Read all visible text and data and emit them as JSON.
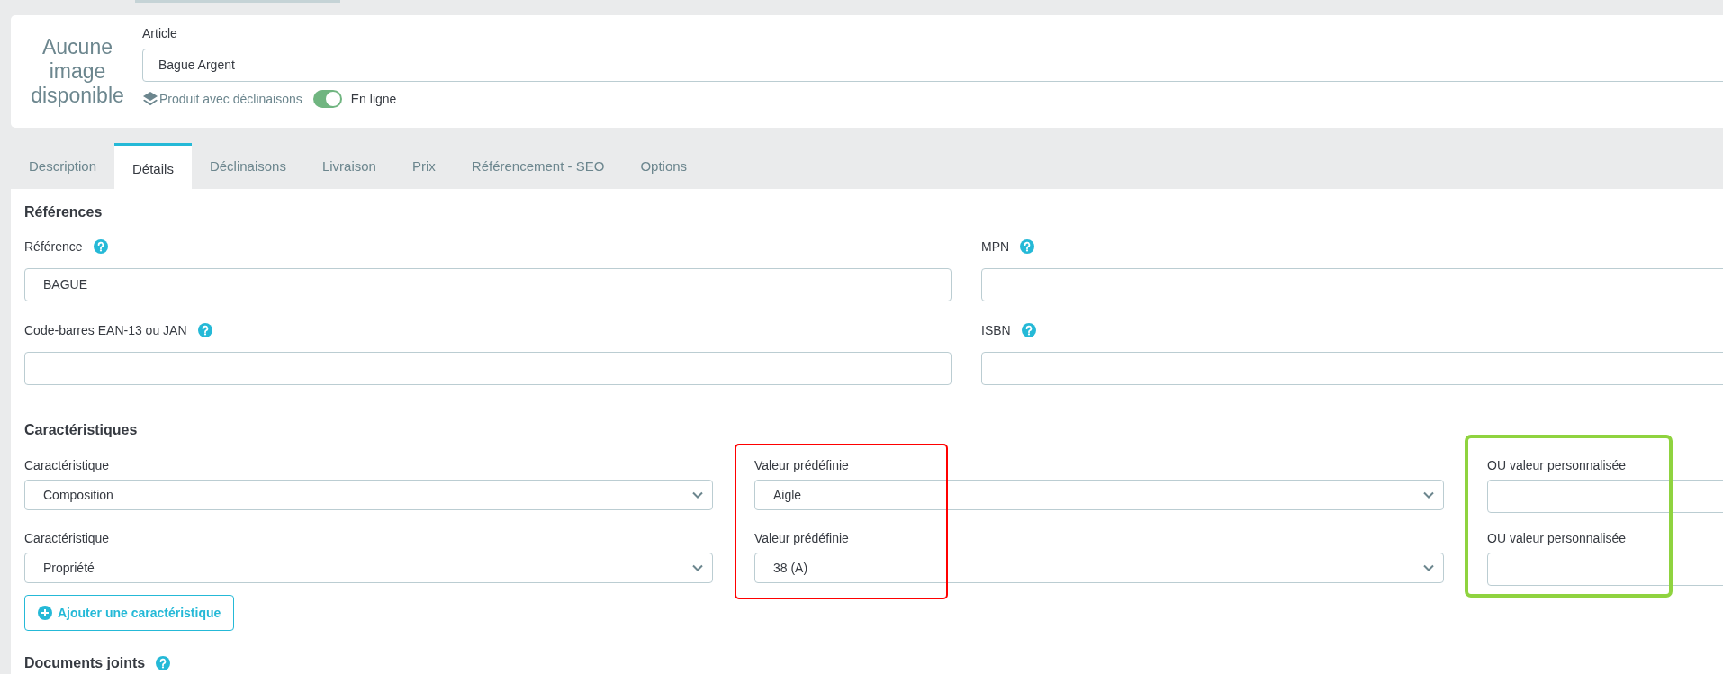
{
  "product_header": {
    "image_placeholder": "Aucune image disponible",
    "article_label": "Article",
    "article_value": "Bague Argent",
    "combinations_label": "Produit avec déclinaisons",
    "online": {
      "on": true,
      "label": "En ligne"
    }
  },
  "tabs": [
    {
      "label": "Description",
      "selected": false
    },
    {
      "label": "Détails",
      "selected": true
    },
    {
      "label": "Déclinaisons",
      "selected": false
    },
    {
      "label": "Livraison",
      "selected": false
    },
    {
      "label": "Prix",
      "selected": false
    },
    {
      "label": "Référencement - SEO",
      "selected": false
    },
    {
      "label": "Options",
      "selected": false
    }
  ],
  "references": {
    "title": "Références",
    "fields": [
      {
        "label": "Référence",
        "help": true,
        "value": "BAGUE"
      },
      {
        "label": "MPN",
        "help": true
      },
      {
        "label": "Code-barres EAN-13 ou JAN",
        "help": true
      },
      {
        "label": "ISBN",
        "help": true
      }
    ]
  },
  "features": {
    "title": "Caractéristiques",
    "rows": [
      {
        "feature_label": "Caractéristique",
        "feature": "Composition",
        "value_label": "Valeur prédéfinie",
        "value": "Aigle",
        "custom_label": "OU valeur personnalisée"
      },
      {
        "feature_label": "Caractéristique",
        "feature": "Propriété",
        "value_label": "Valeur prédéfinie",
        "value": "38 (A)",
        "custom_label": "OU valeur personnalisée"
      }
    ],
    "add_button": "Ajouter une caractéristique"
  },
  "attachments": {
    "title": "Documents joints",
    "help": true
  },
  "highlights": [
    {
      "color": "#ff0000"
    },
    {
      "color": "#8fd33f"
    }
  ]
}
